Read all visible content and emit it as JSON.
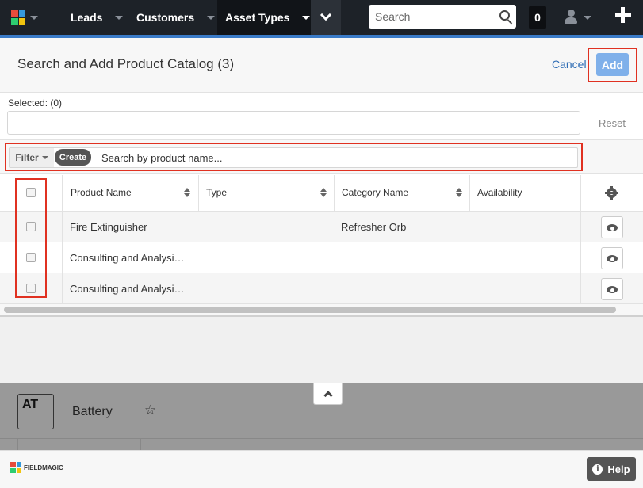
{
  "nav": {
    "items": [
      {
        "label": "Leads"
      },
      {
        "label": "Customers"
      },
      {
        "label": "Asset Types"
      }
    ],
    "search_placeholder": "Search",
    "notification_count": "0"
  },
  "modal": {
    "title": "Search and Add Product Catalog (3)",
    "cancel_label": "Cancel",
    "add_label": "Add",
    "selected_label": "Selected: (0)",
    "reset_label": "Reset",
    "filter_label": "Filter",
    "create_label": "Create",
    "search_placeholder": "Search by product name..."
  },
  "table": {
    "columns": [
      "Product Name",
      "Type",
      "Category Name",
      "Availability"
    ],
    "rows": [
      {
        "product_name": "Fire Extinguisher",
        "type": "",
        "category_name": "Refresher Orb",
        "availability": ""
      },
      {
        "product_name": "Consulting and Analysi…",
        "type": "",
        "category_name": "",
        "availability": ""
      },
      {
        "product_name": "Consulting and Analysi…",
        "type": "",
        "category_name": "",
        "availability": ""
      }
    ]
  },
  "background_page": {
    "avatar_text": "AT",
    "record_title": "Battery"
  },
  "footer": {
    "brand": "FIELDMAGIC",
    "help_label": "Help"
  },
  "colors": {
    "nav_bg": "#1d2228",
    "accent": "#3a7bc8",
    "add_button": "#7fb0ea",
    "highlight": "#e03121",
    "link": "#2f6db5"
  }
}
